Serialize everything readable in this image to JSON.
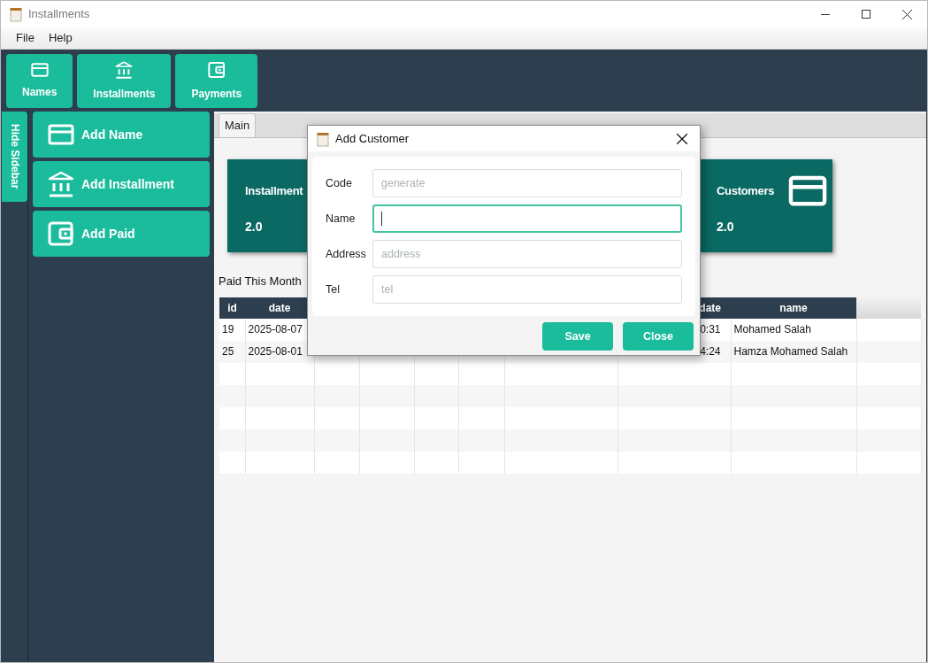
{
  "window": {
    "title": "Installments"
  },
  "menu": [
    "File",
    "Help"
  ],
  "toolbar": [
    {
      "label": "Names",
      "kind": "card"
    },
    {
      "label": "Installments",
      "kind": "bank"
    },
    {
      "label": "Payments",
      "kind": "wallet"
    }
  ],
  "sidebar_toggle": {
    "label": "Hide Sidebar"
  },
  "sidebar": {
    "items": [
      {
        "label": "Add Name",
        "kind": "card"
      },
      {
        "label": "Add Installment",
        "kind": "bank"
      },
      {
        "label": "Add Paid",
        "kind": "wallet"
      }
    ]
  },
  "tabs": [
    {
      "label": "Main",
      "selected": true
    }
  ],
  "cards": [
    {
      "title": "Installment",
      "value": "2.0"
    },
    {
      "title": "Customers",
      "value": "2.0",
      "kind": "card"
    }
  ],
  "table": {
    "title": "Paid This Month",
    "columns": [
      {
        "label": "id"
      },
      {
        "label": "date"
      },
      null,
      null,
      null,
      null,
      null,
      {
        "label": "date"
      },
      {
        "label": "name"
      },
      null
    ],
    "rows": [
      {
        "cells": [
          "19",
          "2025-08-07",
          null,
          null,
          null,
          null,
          null,
          "0:31",
          "Mohamed Salah",
          null
        ]
      },
      {
        "cells": [
          "25",
          "2025-08-01",
          null,
          null,
          null,
          null,
          null,
          "4:24",
          "Hamza Mohamed Salah",
          null
        ]
      }
    ]
  },
  "dialog": {
    "title": "Add Customer",
    "fields": [
      {
        "label": "Code",
        "placeholder": "generate",
        "focused": false
      },
      {
        "label": "Name",
        "focused": true
      },
      {
        "label": "Address",
        "placeholder": "address",
        "focused": false
      },
      {
        "label": "Tel",
        "placeholder": "tel",
        "focused": false
      }
    ],
    "buttons": [
      "Save",
      "Close"
    ]
  }
}
